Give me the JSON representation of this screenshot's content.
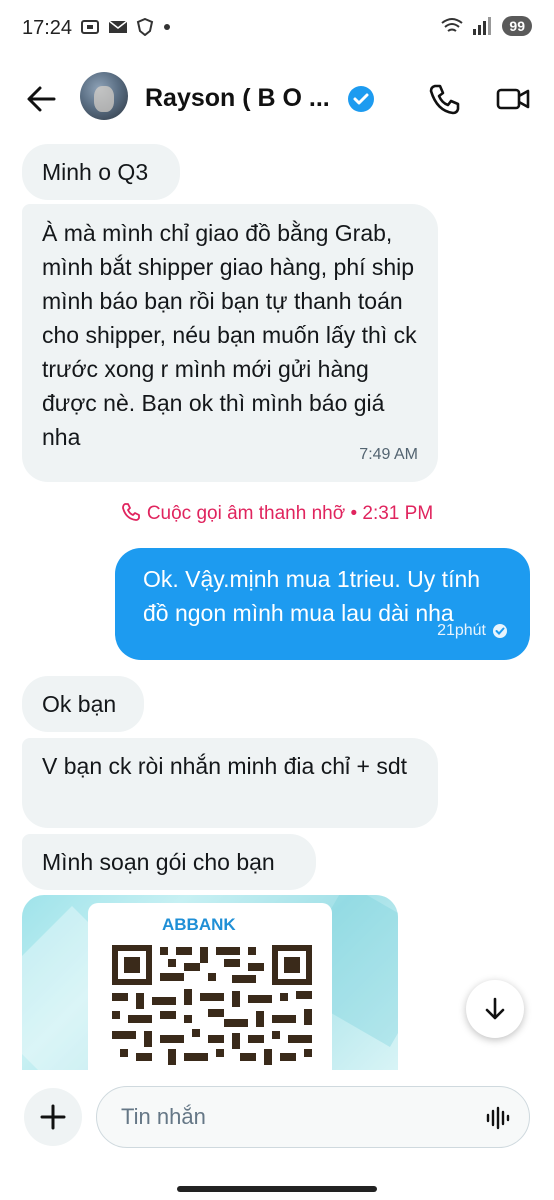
{
  "status": {
    "time": "17:24",
    "battery": "99",
    "signal_badge": "5"
  },
  "header": {
    "name": "Rayson ( B O ...",
    "verified": true
  },
  "messages": {
    "m1": "Minh o Q3",
    "m2": "À mà mình chỉ giao đồ bằng Grab, mình bắt shipper giao hàng, phí ship mình báo bạn rồi bạn tự thanh toán cho shipper, néu bạn muốn lấy thì ck trước xong r mình mới gửi hàng được nè. Bạn ok thì mình báo giá nha",
    "m2_time": "7:49 AM",
    "call_log": "Cuộc gọi âm thanh nhỡ • 2:31 PM",
    "m3": "Ok. Vậy.mịnh mua 1trieu.  Uy tính đồ ngon mình mua lau dài nha",
    "m3_time": "21phút",
    "m4": "Ok bạn",
    "m5": "V bạn ck ròi nhắn minh đia chỉ + sdt",
    "m6": "Mình soạn gói cho bạn",
    "image_bank": "ABBANK"
  },
  "composer": {
    "placeholder": "Tin nhắn"
  },
  "colors": {
    "accent": "#1d9bf0",
    "incoming": "#eff3f4",
    "missed_call": "#e0245e"
  }
}
